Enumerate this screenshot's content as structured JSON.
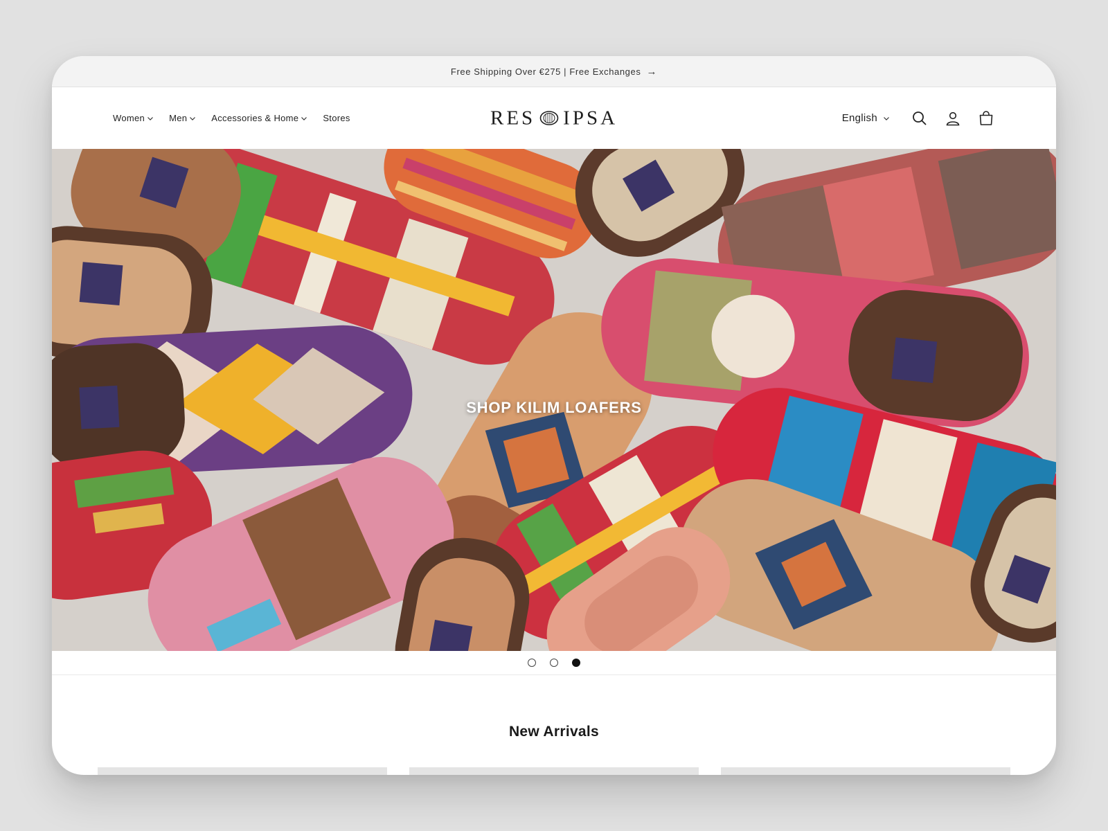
{
  "announcement": {
    "text": "Free Shipping Over €275 | Free Exchanges"
  },
  "nav": [
    {
      "label": "Women",
      "has_dropdown": true
    },
    {
      "label": "Men",
      "has_dropdown": true
    },
    {
      "label": "Accessories & Home",
      "has_dropdown": true
    },
    {
      "label": "Stores",
      "has_dropdown": false
    }
  ],
  "brand": {
    "left": "RES",
    "right": "IPSA"
  },
  "header": {
    "language": "English"
  },
  "icons": [
    "search-icon",
    "account-icon",
    "cart-icon",
    "chevron-down-icon",
    "arrow-right-icon"
  ],
  "hero": {
    "cta": "SHOP KILIM LOAFERS"
  },
  "slideshow": {
    "total_slides": 3,
    "active_slide": 3
  },
  "sections": {
    "new_arrivals": "New Arrivals"
  },
  "colors": {
    "announcement_bg": "#f3f3f3",
    "page_bg": "#e1e1e1",
    "text": "#1a1a1a",
    "dot_active": "#111111"
  }
}
